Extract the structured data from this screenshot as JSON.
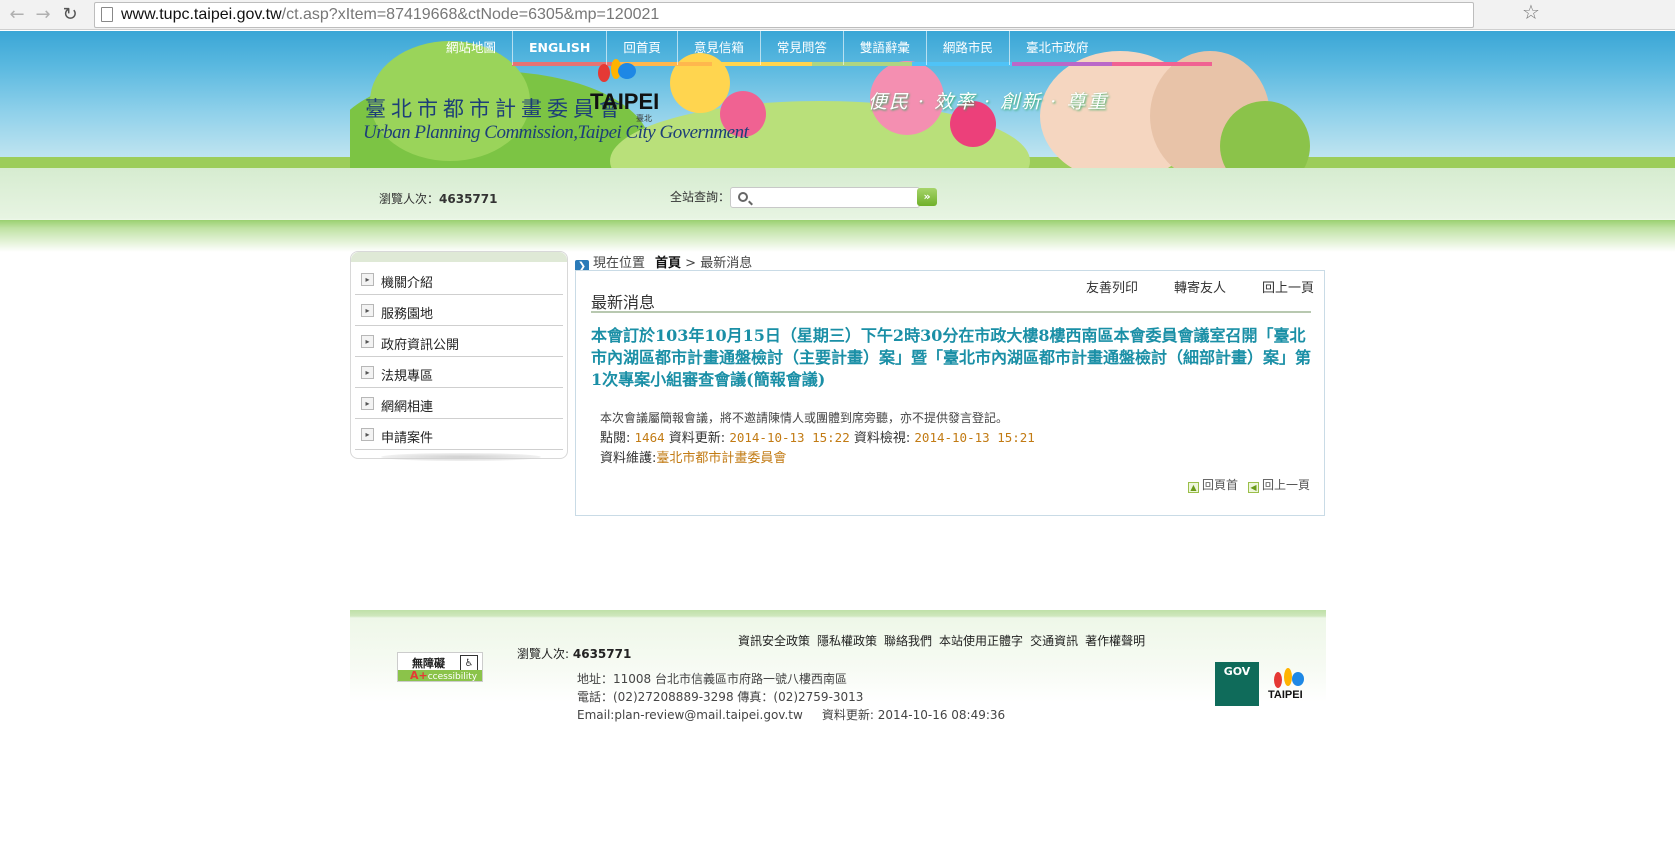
{
  "browser": {
    "url_host": "www.tupc.taipei.gov.tw",
    "url_path": "/ct.asp?xItem=87419668&ctNode=6305&mp=120021"
  },
  "topnav": [
    "網站地圖",
    "ENGLISH",
    "回首頁",
    "意見信箱",
    "常見問答",
    "雙語辭彙",
    "網路市民",
    "臺北市政府"
  ],
  "header": {
    "title": "臺北市都市計畫委員會",
    "subtitle": "Urban Planning Commission,Taipei City Government",
    "logo_text": "TAIPEI",
    "logo_sub": "臺北",
    "slogan": "便民 · 效率 · 創新 · 尊重"
  },
  "search": {
    "visits_label": "瀏覽人次：",
    "visits_count": "4635771",
    "label": "全站查詢：",
    "placeholder": "",
    "button": "»"
  },
  "sidebar": {
    "items": [
      {
        "label": "機關介紹"
      },
      {
        "label": "服務園地"
      },
      {
        "label": "政府資訊公開"
      },
      {
        "label": "法規專區"
      },
      {
        "label": "網網相連"
      },
      {
        "label": "申請案件"
      }
    ]
  },
  "breadcrumb": {
    "label": "現在位置",
    "home": "首頁",
    "sep": ">",
    "current": "最新消息"
  },
  "content": {
    "tools": [
      "友善列印",
      "轉寄友人",
      "回上一頁"
    ],
    "section_title": "最新消息",
    "news_title": "本會訂於103年10月15日（星期三）下午2時30分在市政大樓8樓西南區本會委員會議室召開「臺北市內湖區都市計畫通盤檢討（主要計畫）案」暨「臺北市內湖區都市計畫通盤檢討（細部計畫）案」第1次專案小組審查會議(簡報會議)",
    "body": "本次會議屬簡報會議，將不邀請陳情人或團體到席旁聽，亦不提供發言登記。",
    "hits_label": "點閱:",
    "hits": "1464",
    "updated_label": "資料更新:",
    "updated": "2014-10-13 15:22",
    "checked_label": "資料檢視:",
    "checked": "2014-10-13 15:21",
    "maintainer_label": "資料維護:",
    "maintainer": "臺北市都市計畫委員會",
    "bottom_links": [
      "回頁首",
      "回上一頁"
    ]
  },
  "footer": {
    "links": [
      "資訊安全政策",
      "隱私權政策",
      "聯絡我們",
      "本站使用正體字",
      "交通資訊",
      "著作權聲明"
    ],
    "accessibility": {
      "line1": "無障礙",
      "line2_a": "A+",
      "line2_b": "ccessibility"
    },
    "visits_label": "瀏覽人次:",
    "visits_count": "4635771",
    "address": "地址：11008 台北市信義區市府路一號八樓西南區",
    "phone": "電話：(02)27208889-3298 傳真：(02)2759-3013",
    "email": "Email:plan-review@mail.taipei.gov.tw",
    "updated": "資料更新: 2014-10-16 08:49:36",
    "gov_logo": "GOV",
    "taipei_logo": "TAIPEI"
  }
}
